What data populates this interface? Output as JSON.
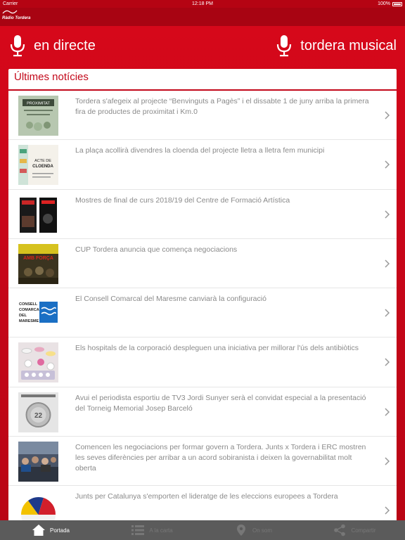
{
  "status_bar": {
    "carrier": "Carrier",
    "time": "12:18 PM",
    "battery": "100%"
  },
  "header": {
    "logo_text": "Ràdio Tordera"
  },
  "radio": {
    "live_label": "en directe",
    "music_label": "tordera musical"
  },
  "news": {
    "section_title": "Últimes notícies",
    "items": [
      {
        "title": "Tordera s'afegeix al projecte “Benvinguts a Pagès” i el dissabte 1 de juny arriba la primera fira de productes de proximitat i Km.0",
        "thumb": "proximitat-poster"
      },
      {
        "title": "La plaça acollirà divendres la cloenda del projecte lletra a lletra fem municipi",
        "thumb": "acte-de-cloenda-poster"
      },
      {
        "title": "Mostres de final de curs 2018/19 del Centre de Formació Artística",
        "thumb": "art-posters"
      },
      {
        "title": "CUP Tordera anuncia que comença negociacions",
        "thumb": "amb-forca-banner"
      },
      {
        "title": "El Consell Comarcal del Maresme canviarà la configuració",
        "thumb": "consell-comarcal-logo"
      },
      {
        "title": "Els hospitals de la corporació despleguen una iniciativa per millorar l'ús dels antibiòtics",
        "thumb": "pills-photo"
      },
      {
        "title": "Avui el periodista esportiu de TV3 Jordi Sunyer serà el convidat especial a la presentació del Torneig Memorial Josep Barceló",
        "thumb": "trophy-poster"
      },
      {
        "title": "Comencen les negociacions per formar govern a Tordera. Junts x Tordera i ERC mostren les seves diferències per arribar a un acord sobiranista i deixen la governabilitat molt oberta",
        "thumb": "council-meeting-photo"
      },
      {
        "title": "Junts per Catalunya s'emporten el lideratge de les eleccions europees a Tordera",
        "thumb": "election-pie-chart"
      }
    ]
  },
  "tabs": [
    {
      "label": "Portada",
      "icon": "home-icon",
      "active": true
    },
    {
      "label": "A la carta",
      "icon": "list-icon",
      "active": false
    },
    {
      "label": "On som",
      "icon": "map-pin-icon",
      "active": false
    },
    {
      "label": "Compartir",
      "icon": "share-icon",
      "active": false
    }
  ],
  "colors": {
    "brand_red": "#c9061a",
    "tab_bar": "#5b5b5b"
  },
  "thumb_texts": {
    "proximitat": "PROXIMITAT",
    "cloenda_line1": "ACTE DE",
    "cloenda_line2": "CLOENDA",
    "amb_forca": "AMB FORÇA",
    "consell_1": "CONSELL",
    "consell_2": "COMARCAL",
    "consell_3": "DEL",
    "consell_4": "MARESME",
    "trophy_number": "22"
  }
}
